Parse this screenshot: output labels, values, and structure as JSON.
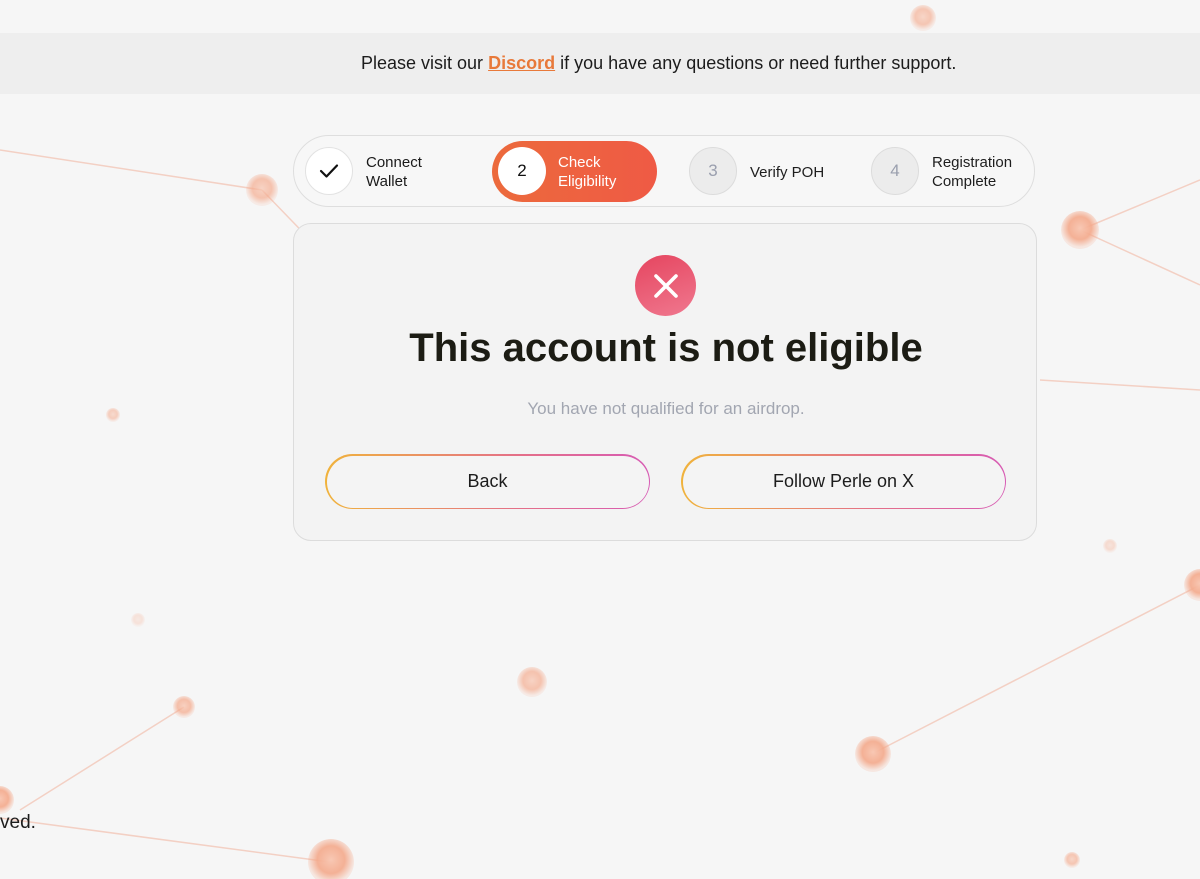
{
  "banner": {
    "prefix": "Please visit our",
    "link_label": "Discord",
    "suffix": "if you have any questions or need further support."
  },
  "stepper": {
    "steps": [
      {
        "number": "",
        "label_line1": "Connect",
        "label_line2": "Wallet",
        "state": "completed",
        "icon": "check-icon"
      },
      {
        "number": "2",
        "label_line1": "Check",
        "label_line2": "Eligibility",
        "state": "active"
      },
      {
        "number": "3",
        "label_line1": "Verify POH",
        "label_line2": "",
        "state": "pending"
      },
      {
        "number": "4",
        "label_line1": "Registration",
        "label_line2": "Complete",
        "state": "pending"
      }
    ]
  },
  "result": {
    "icon": "close-icon",
    "title": "This account is not eligible",
    "subtitle": "You have not qualified for an airdrop."
  },
  "actions": {
    "back_label": "Back",
    "follow_label": "Follow Perle on X"
  },
  "footer": {
    "fragment": "ved."
  },
  "colors": {
    "accent": "#ec6a3c",
    "link": "#e8793a",
    "error": "#e5455f",
    "muted_text": "#a2a6b1"
  }
}
